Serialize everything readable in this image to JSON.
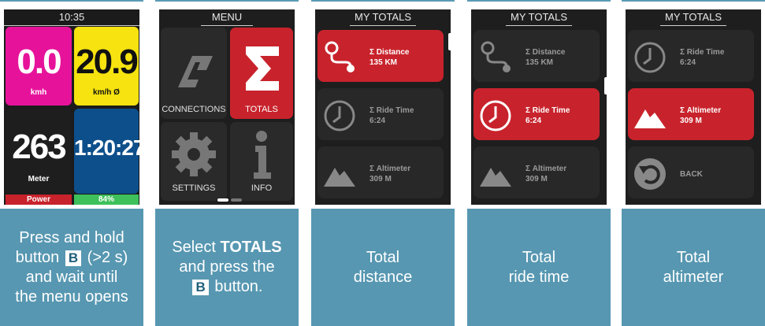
{
  "panel1": {
    "time": "10:35",
    "speed_value": "0.0",
    "speed_unit": "kmh",
    "avg_value": "20.9",
    "avg_unit": "km/h Ø",
    "alt_value": "263",
    "alt_unit": "Meter",
    "ride_value": "1:20:27",
    "power_label": "Power",
    "battery_label": "84%",
    "caption_line1": "Press and hold",
    "caption_pre_key": "button",
    "caption_key": "B",
    "caption_post_key": "(>2 s)",
    "caption_line3": "and wait until",
    "caption_line4": "the menu opens"
  },
  "panel2": {
    "title": "MENU",
    "connections_label": "CONNECTIONS",
    "totals_label": "TOTALS",
    "settings_label": "SETTINGS",
    "info_label": "INFO",
    "caption_pre": "Select",
    "caption_bold": "TOTALS",
    "caption_line2": "and press the",
    "caption_key": "B",
    "caption_post_key": "button."
  },
  "panel3": {
    "title": "MY TOTALS",
    "rows": [
      {
        "label": "Σ Distance",
        "value": "135 KM"
      },
      {
        "label": "Σ Ride Time",
        "value": "6:24"
      },
      {
        "label": "Σ Altimeter",
        "value": "309 M"
      }
    ],
    "caption_line1": "Total",
    "caption_line2": "distance"
  },
  "panel4": {
    "title": "MY TOTALS",
    "rows": [
      {
        "label": "Σ Distance",
        "value": "135 KM"
      },
      {
        "label": "Σ Ride Time",
        "value": "6:24"
      },
      {
        "label": "Σ Altimeter",
        "value": "309 M"
      }
    ],
    "caption_line1": "Total",
    "caption_line2": "ride time"
  },
  "panel5": {
    "title": "MY TOTALS",
    "rows": [
      {
        "label": "Σ Ride Time",
        "value": "6:24"
      },
      {
        "label": "Σ Altimeter",
        "value": "309 M"
      },
      {
        "label": "BACK",
        "value": ""
      }
    ],
    "caption_line1": "Total",
    "caption_line2": "altimeter"
  },
  "colors": {
    "speed_tile": "#e6139a",
    "avg_tile": "#f6e30f",
    "alt_tile": "#1e1e1e",
    "ride_tile": "#0d4f8b",
    "power_bar": "#c8232c",
    "battery_bar": "#3ec05a",
    "selected_row": "#c8232c",
    "caption_bg": "#5797b1"
  },
  "icons": [
    "connections-icon",
    "sigma-icon",
    "gear-icon",
    "info-icon",
    "route-icon",
    "clock-icon",
    "mountain-icon",
    "back-icon"
  ]
}
